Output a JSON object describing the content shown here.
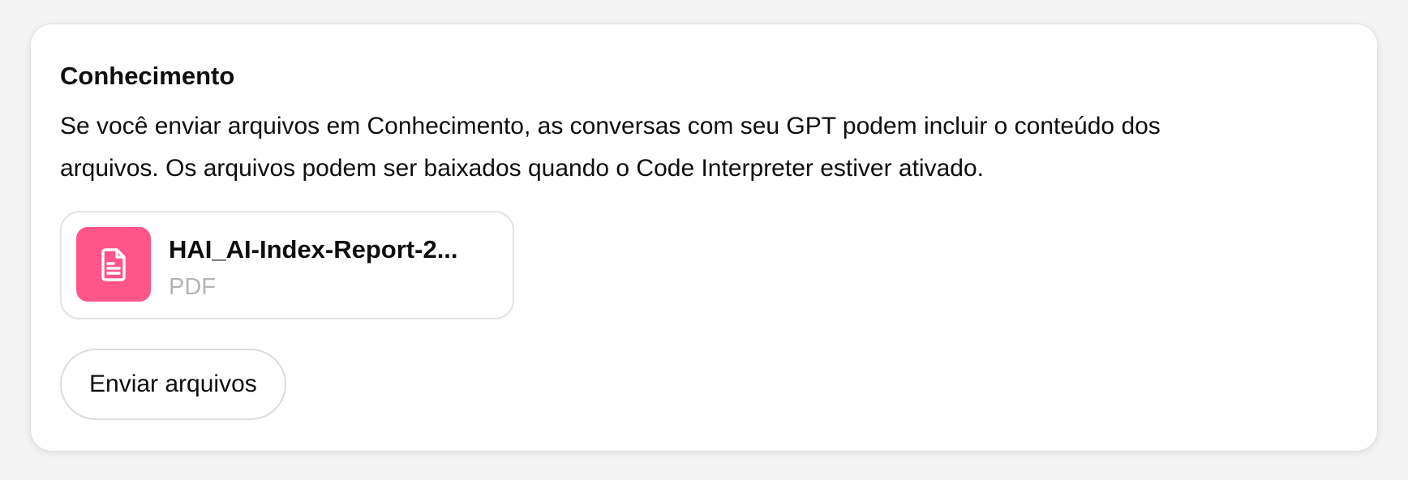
{
  "knowledge": {
    "title": "Conhecimento",
    "description": "Se você enviar arquivos em Conhecimento, as conversas com seu GPT podem incluir o conteúdo dos arquivos. Os arquivos podem ser baixados quando o Code Interpreter estiver ativado.",
    "files": [
      {
        "name": "HAI_AI-Index-Report-2...",
        "type": "PDF",
        "icon": "document-icon",
        "icon_color": "#ff5588"
      }
    ],
    "upload_label": "Enviar arquivos"
  },
  "colors": {
    "accent": "#ff5588",
    "muted_text": "#b4b4b4",
    "border": "#e3e3e3"
  }
}
